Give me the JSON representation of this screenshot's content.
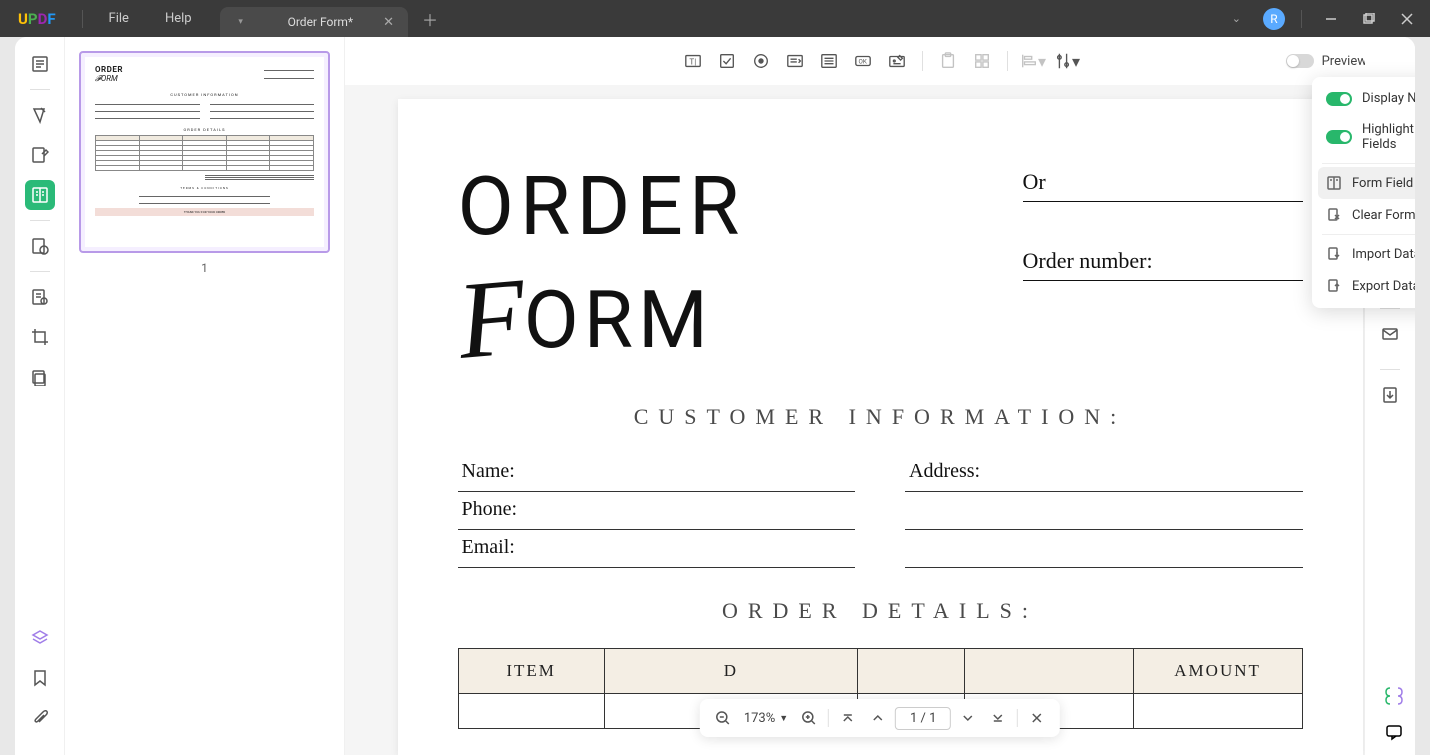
{
  "app": {
    "logo": {
      "u": "U",
      "p": "P",
      "d": "D",
      "f": "F"
    },
    "menu": {
      "file": "File",
      "help": "Help"
    },
    "tab_title": "Order Form*",
    "avatar_letter": "R"
  },
  "toolbar": {
    "preview_label": "Preview"
  },
  "dropdown": {
    "display_name": "Display Name",
    "highlight_fields": "Highlight Existing Fields",
    "form_recognition": "Form Field Recognition",
    "clear_form": "Clear Form",
    "import_data": "Import Data (.fdf)",
    "export_data": "Export Data (.fdf)"
  },
  "thumbnails": {
    "page_number": "1"
  },
  "document": {
    "title_line1": "ORDER",
    "title_line2_rest": "ORM",
    "order_date_label": "Or",
    "order_number_label": "Order number:",
    "section_customer": "CUSTOMER INFORMATION:",
    "fields": {
      "name": "Name:",
      "phone": "Phone:",
      "email": "Email:",
      "address": "Address:"
    },
    "section_details": "ORDER DETAILS:",
    "table": {
      "item": "ITEM",
      "desc_trunc": "D",
      "amount": "AMOUNT"
    }
  },
  "pagenav": {
    "zoom": "173%",
    "pages": "1 / 1"
  }
}
